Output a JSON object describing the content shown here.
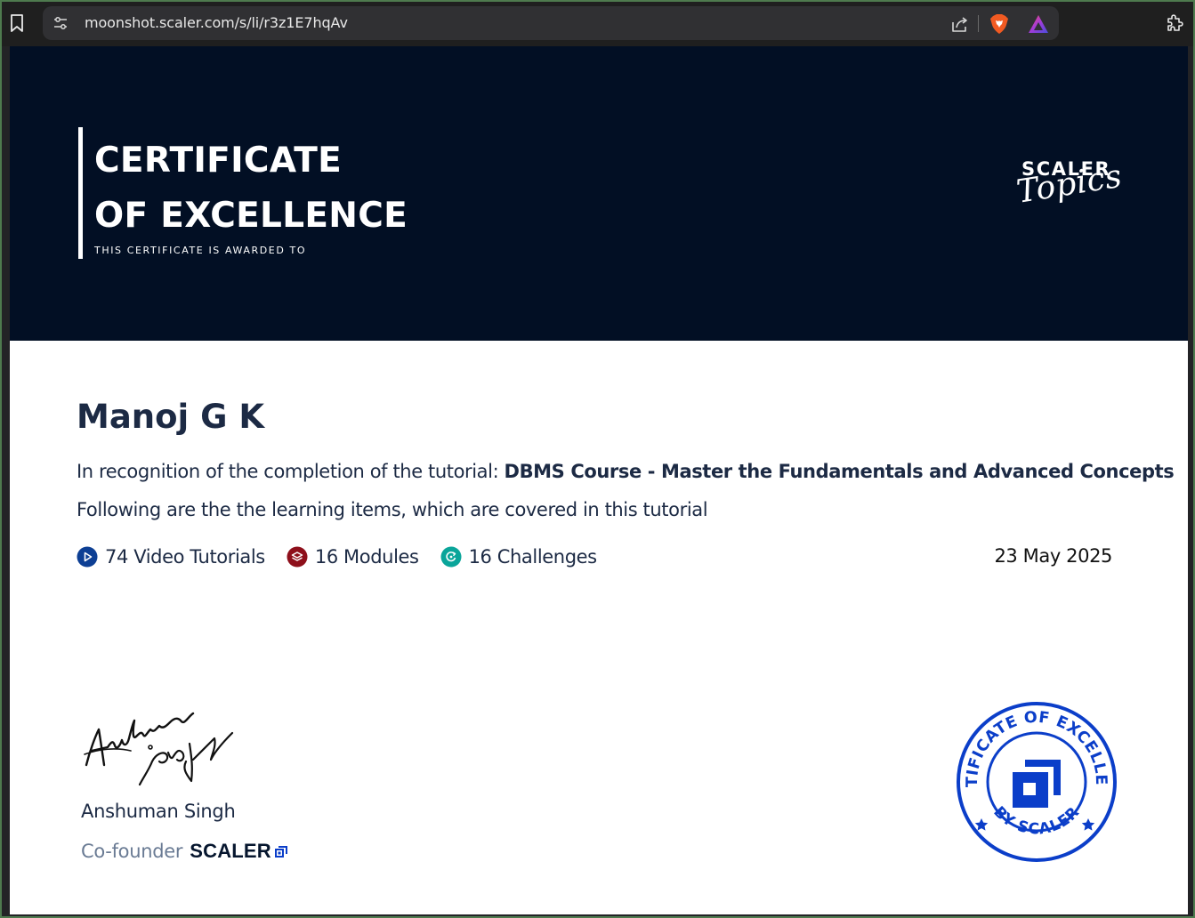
{
  "browser": {
    "url": "moonshot.scaler.com/s/li/r3z1E7hqAv"
  },
  "certificate": {
    "title_line1": "CERTIFICATE",
    "title_line2": "OF EXCELLENCE",
    "subtitle": "THIS CERTIFICATE IS AWARDED TO",
    "brand_word": "SCALER",
    "brand_script": "Topics",
    "recipient": "Manoj G K",
    "recognition_prefix": "In recognition of the completion of the tutorial: ",
    "course_name": "DBMS Course - Master the Fundamentals and Advanced Concepts",
    "items_text": "Following are the the learning items, which are covered in this tutorial",
    "stats": [
      {
        "label": "74 Video Tutorials",
        "icon": "play-icon",
        "color": "#0d3f94"
      },
      {
        "label": "16 Modules",
        "icon": "module-stack-icon",
        "color": "#8e0f1b"
      },
      {
        "label": "16 Challenges",
        "icon": "challenge-icon",
        "color": "#0aa59a"
      }
    ],
    "date": "23 May 2025",
    "signer_name": "Anshuman Singh",
    "signer_role": "Co-founder",
    "signer_company": "SCALER",
    "seal_top_text": "CERTIFICATE OF EXCELLENCE",
    "seal_bottom_text": "BY SCALER"
  },
  "colors": {
    "hero_background": "#020f24",
    "text_primary": "#1c2a44",
    "seal_blue": "#0b3ec9",
    "frame_green": "#4e7a4e"
  }
}
